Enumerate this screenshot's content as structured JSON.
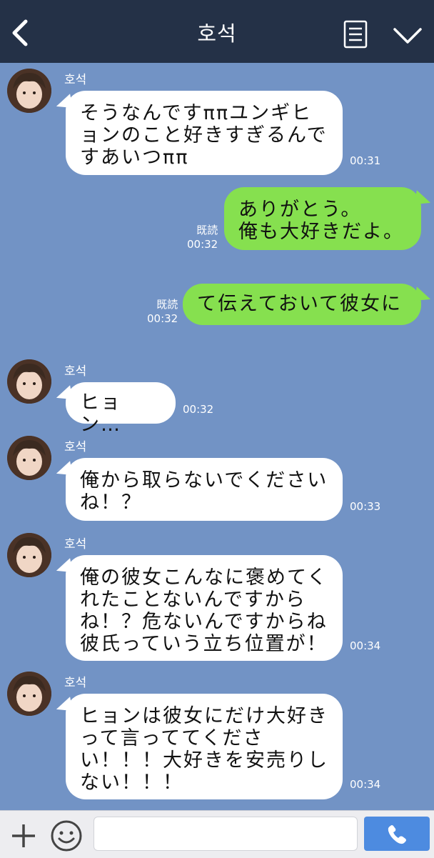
{
  "header": {
    "title": "호석",
    "back_icon": "back-arrow-icon",
    "notes_icon": "note-icon",
    "menu_icon": "chevron-down-icon",
    "background": "#243147"
  },
  "chat": {
    "background": "#7293c5",
    "bubble_in_color": "#ffffff",
    "bubble_out_color": "#86e04f",
    "messages": [
      {
        "direction": "in",
        "sender": "호석",
        "text": "そうなんですππユンギヒ\nョンのこと好きすぎるんで\nすあいつππ",
        "time": "00:31"
      },
      {
        "direction": "out",
        "read": "既読",
        "text": "ありがとう。\n俺も大好きだよ。",
        "time": "00:32"
      },
      {
        "direction": "out",
        "read": "既読",
        "text": "て伝えておいて彼女に",
        "time": "00:32"
      },
      {
        "direction": "in",
        "sender": "호석",
        "text": "ヒョン…",
        "time": "00:32"
      },
      {
        "direction": "in",
        "sender": "호석",
        "text": "俺から取らないでくださいね！？",
        "time": "00:33"
      },
      {
        "direction": "in",
        "sender": "호석",
        "text": "俺の彼女こんなに褒めてくれたことないんですからね！？危ないんですからね彼氏っていう立ち位置が！",
        "time": "00:34"
      },
      {
        "direction": "in",
        "sender": "호석",
        "text": "ヒョンは彼女にだけ大好きって言っててください！！！大好きを安売りしない！！！",
        "time": "00:34"
      }
    ]
  },
  "footer": {
    "plus_icon": "plus-icon",
    "emoji_icon": "smiley-icon",
    "input_value": "",
    "call_icon": "phone-icon",
    "call_color": "#4d8be0"
  }
}
